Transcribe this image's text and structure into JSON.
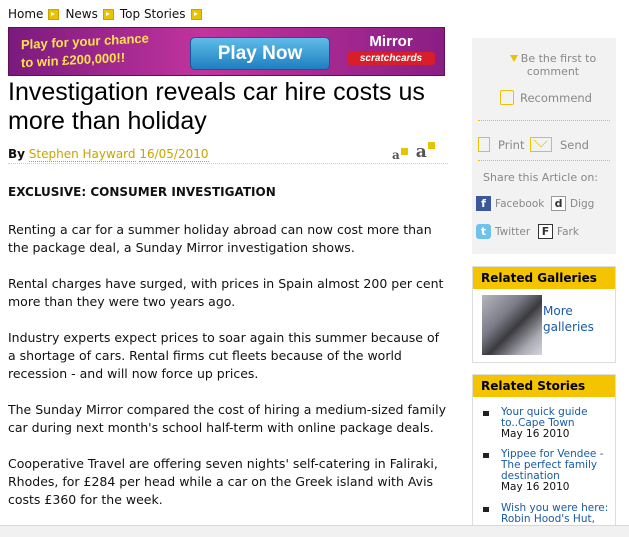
{
  "breadcrumb": {
    "items": [
      "Home",
      "News",
      "Top Stories"
    ]
  },
  "banner": {
    "promo_line1": "Play for your chance",
    "promo_line2": "to win £200,000!!",
    "button": "Play Now",
    "brand": "Mirror",
    "brand_sub": "scratchcards"
  },
  "article": {
    "headline": "Investigation reveals car hire costs us more than holiday",
    "by": "By",
    "author": "Stephen Hayward",
    "date": "16/05/2010",
    "font_small": "a",
    "font_large": "a",
    "kicker": "EXCLUSIVE: CONSUMER INVESTIGATION",
    "paragraphs": [
      "Renting a car for a summer holiday abroad can now cost more than the package deal, a Sunday Mirror investigation shows.",
      "Rental charges have surged, with prices in Spain almost 200 per cent more than they were two years ago.",
      "Industry experts expect prices to soar again this summer because of a shortage of cars. Rental firms cut fleets because of the world recession - and will now force up prices.",
      "The Sunday Mirror compared the cost of hiring a medium-sized family car during next month's school half-term with online package deals.",
      "Cooperative Travel are offering seven nights' self-catering in Faliraki, Rhodes, for £284 per head while a car on the Greek island with Avis costs £360 for the week."
    ]
  },
  "sidebar": {
    "comment": "Be the first to comment",
    "recommend": "Recommend",
    "print": "Print",
    "send": "Send",
    "share_label": "Share this Article on:",
    "share": {
      "facebook": "Facebook",
      "digg": "Digg",
      "twitter": "Twitter",
      "fark": "Fark"
    },
    "galleries": {
      "heading": "Related Galleries",
      "link": "More galleries"
    },
    "stories": {
      "heading": "Related Stories",
      "items": [
        {
          "title": "Your quick guide to..Cape Town",
          "date": "May 16 2010"
        },
        {
          "title": "Yippee for Vendee - The perfect family destination",
          "date": "May 16 2010"
        },
        {
          "title": "Wish you were here: Robin Hood's Hut,",
          "date": ""
        }
      ]
    }
  },
  "colors": {
    "accent": "#f5c400",
    "link": "#1a5aa6",
    "author": "#c9a400"
  }
}
